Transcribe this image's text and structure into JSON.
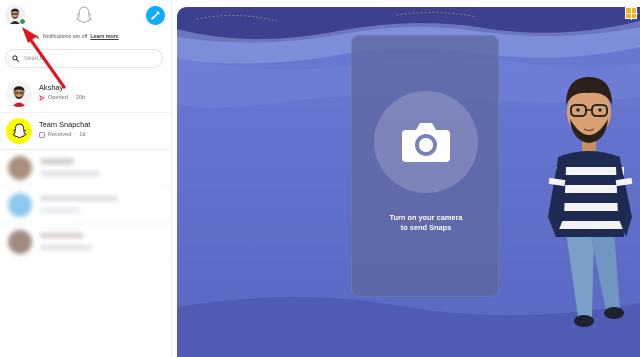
{
  "window": {
    "accent": "#0eadff",
    "brand_yellow": "#fffc00"
  },
  "topbar": {
    "avatar_icon": "bitmoji-avatar-icon",
    "ghost_icon": "snapchat-ghost-icon",
    "new_chat_icon": "new-chat-icon"
  },
  "notification": {
    "text": "Notifications are off",
    "link": "Learn more",
    "icon": "bell-off-icon"
  },
  "search": {
    "placeholder": "Search",
    "icon": "search-icon"
  },
  "conversations": [
    {
      "name": "Akshay",
      "status": "Opened",
      "time": "20h",
      "status_icon": "opened-snap-icon",
      "status_color": "#e8344e"
    },
    {
      "name": "Team Snapchat",
      "status": "Received",
      "time": "1d",
      "status_icon": "received-chat-icon",
      "status_color": "#9b5de5"
    }
  ],
  "main": {
    "camera_icon": "camera-icon",
    "camera_text_line1": "Turn on your camera",
    "camera_text_line2": "to send Snaps",
    "separator": " · "
  }
}
